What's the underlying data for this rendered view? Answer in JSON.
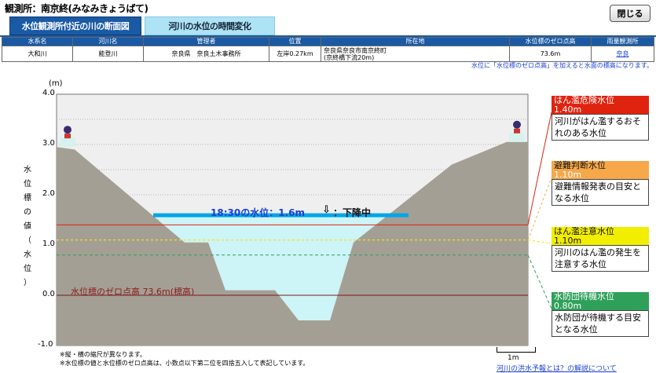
{
  "station": {
    "title": "観測所：南京終(みなみきょうばて)"
  },
  "header": {
    "close_label": "閉じる"
  },
  "tabs": [
    {
      "label": "水位観測所付近の川の断面図",
      "active": true
    },
    {
      "label": "河川の水位の時間変化",
      "active": false
    }
  ],
  "info_table": {
    "headers": [
      "水系名",
      "河川名",
      "管理者",
      "位置",
      "所在地",
      "水位標のゼロ点高",
      "雨量観測所"
    ],
    "row": {
      "system": "大和川",
      "river": "能登川",
      "manager": "奈良県　奈良土木事務所",
      "position": "左岸0.27km",
      "address_line1": "奈良県奈良市南京終町",
      "address_line2": "(京終橋下流20m)",
      "zero_height": "73.6m",
      "rain_station": "奈良"
    }
  },
  "note_right": "水位に「水位標のゼロ点高」を加えると水面の標高になります。",
  "chart": {
    "y_unit": "(m)",
    "y_ticks": [
      "4.0",
      "3.0",
      "2.0",
      "1.0",
      "0.0",
      "-1.0"
    ],
    "y_axis_title": [
      "水",
      "位",
      "標",
      "の",
      "値",
      "（",
      "水",
      "位",
      "）"
    ],
    "current_water": {
      "time": "18:30",
      "label": "18:30の水位：1.6m",
      "value": 1.6,
      "trend": "下降中"
    },
    "zero_label": "水位標のゼロ点高 73.6m(標高)",
    "scale_label": "1m",
    "colors": {
      "flood_danger": "#e0230f",
      "evacuation": "#f6a84a",
      "caution": "#f2ee00",
      "standby": "#2fa05a",
      "water": "#00a6e8",
      "ground": "#a49f95"
    }
  },
  "chart_data": {
    "type": "area",
    "title": "",
    "xlabel": "",
    "ylabel": "水位標の値（水位）",
    "y_unit": "m",
    "ylim": [
      -1.0,
      4.0
    ],
    "y_ticks": [
      4.0,
      3.0,
      2.0,
      1.0,
      0.0,
      -1.0
    ],
    "grid": true,
    "current_water_level": 1.6,
    "thresholds": [
      {
        "name": "はん濫危険水位",
        "value": 1.4
      },
      {
        "name": "避難判断水位",
        "value": 1.1
      },
      {
        "name": "はん濫注意水位",
        "value": 1.1
      },
      {
        "name": "水防団待機水位",
        "value": 0.8
      }
    ],
    "zero_point_elevation": 73.6
  },
  "legend": [
    {
      "title": "はん濫危険水位",
      "value": "1.40m",
      "desc": "河川がはん濫するおそれのある水位",
      "color": "#e0230f",
      "title_color": "#ffffff"
    },
    {
      "title": "避難判断水位",
      "value": "1.10m",
      "desc": "避難情報発表の目安となる水位",
      "color": "#f6a84a",
      "title_color": "#111111"
    },
    {
      "title": "はん濫注意水位",
      "value": "1.10m",
      "desc": "河川のはん濫の発生を注意する水位",
      "color": "#f2ee00",
      "title_color": "#111111"
    },
    {
      "title": "水防団待機水位",
      "value": "0.80m",
      "desc": "水防団が待機する目安となる水位",
      "color": "#2fa05a",
      "title_color": "#ffffff"
    }
  ],
  "footnotes": [
    "※縦・横の縮尺が異なります。",
    "※水位標の値と水位標のゼロ点高は、小数点以下第二位を四捨五入して表記しています。"
  ],
  "bottom_link": "河川の洪水予報とは？の解説について"
}
